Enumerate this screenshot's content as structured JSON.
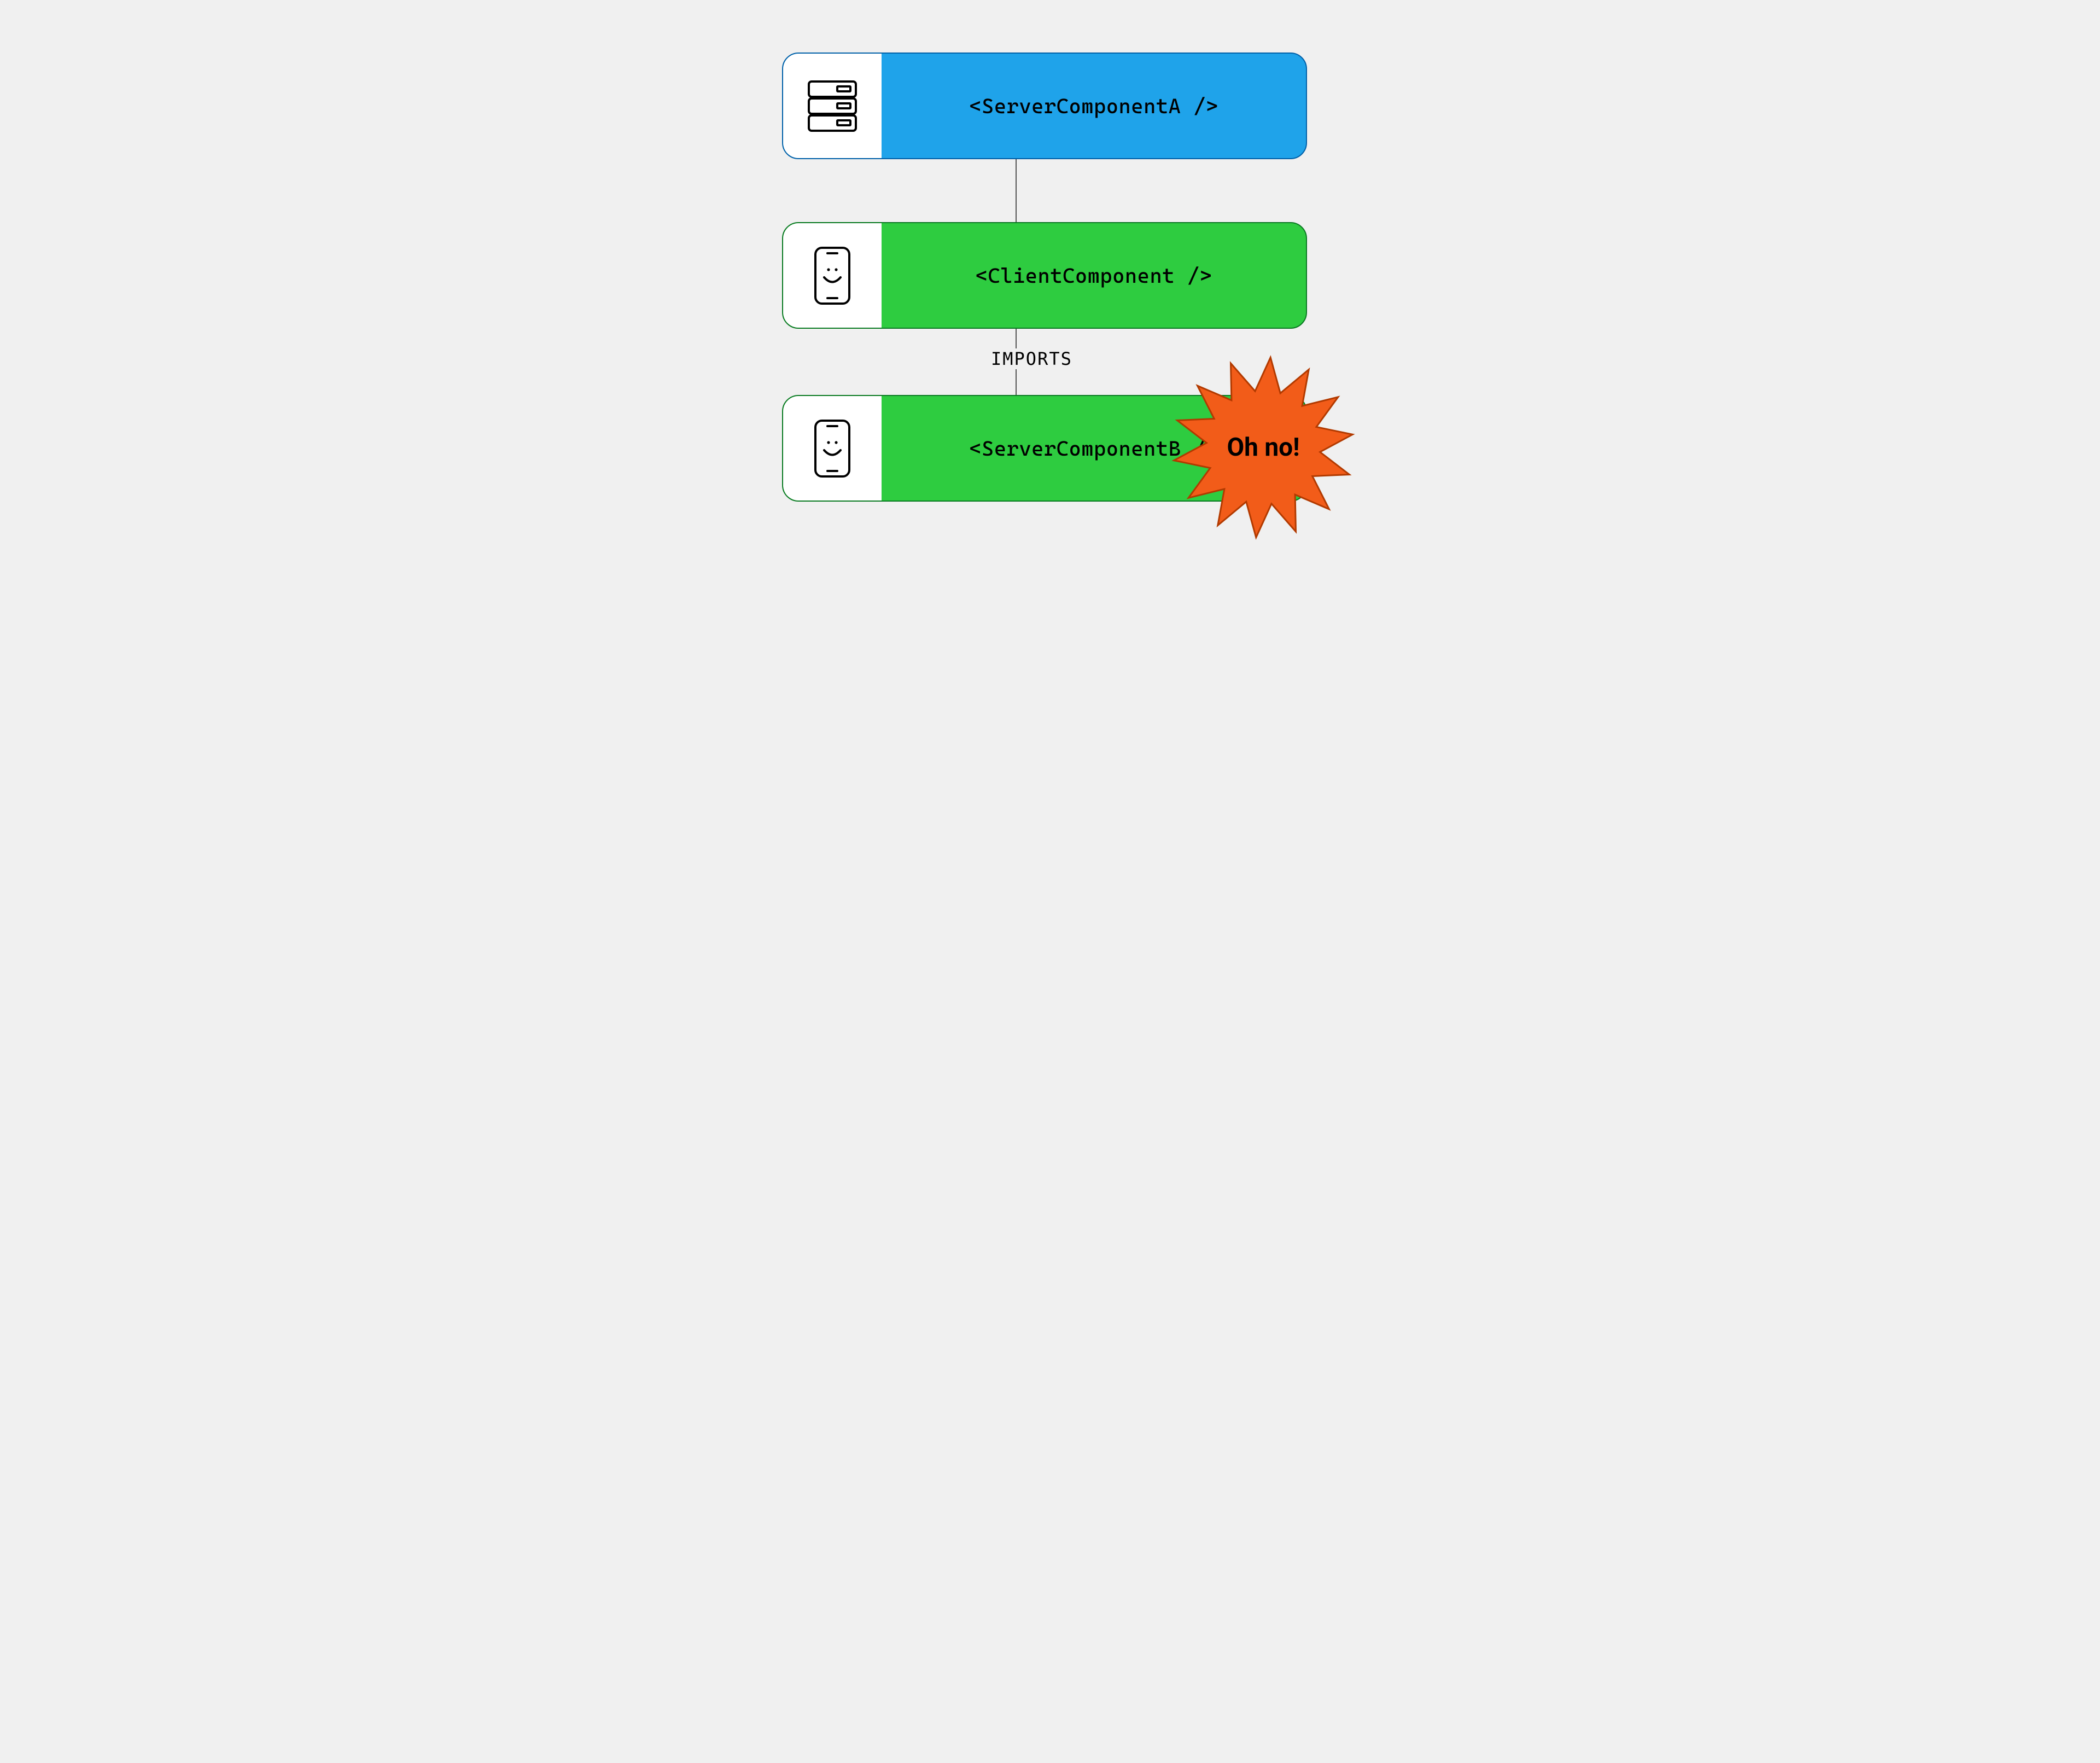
{
  "nodes": {
    "server_a": {
      "label": "<ServerComponentA />",
      "icon": "server"
    },
    "client": {
      "label": "<ClientComponent />",
      "icon": "phone"
    },
    "server_b": {
      "label": "<ServerComponentB />",
      "icon": "phone"
    }
  },
  "connectors": {
    "imports_label": "IMPORTS"
  },
  "burst": {
    "label": "Oh no!"
  },
  "colors": {
    "server_fill": "#1fa3ea",
    "server_border": "#0060a8",
    "client_fill": "#2ecc40",
    "client_border": "#0a7a22",
    "burst_fill": "#f25c19",
    "burst_stroke": "#b23a00"
  }
}
